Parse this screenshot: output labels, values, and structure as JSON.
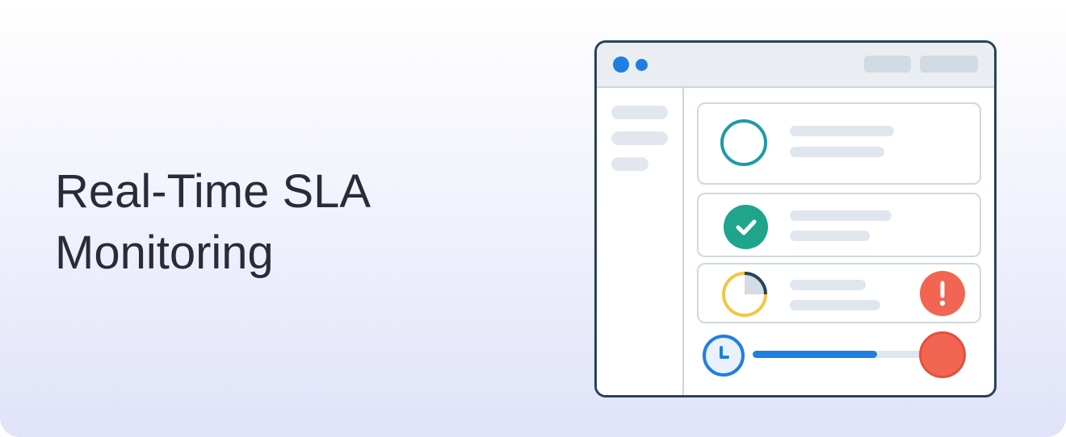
{
  "title": {
    "line1": "Real-Time SLA",
    "line2": "Monitoring"
  },
  "colors": {
    "primary_blue": "#1f7fe0",
    "teal": "#1f9aa8",
    "green": "#1fa58c",
    "amber": "#f5c542",
    "alert_red": "#f36553",
    "dark_text": "#272d38",
    "window_border": "#27435a"
  },
  "icons": {
    "pending": "open-ring-icon",
    "met": "check-circle-icon",
    "at_risk": "pie-timer-icon",
    "alert": "exclamation-circle-icon",
    "timer": "clock-icon"
  },
  "sla_timer": {
    "progress": 0.67
  }
}
